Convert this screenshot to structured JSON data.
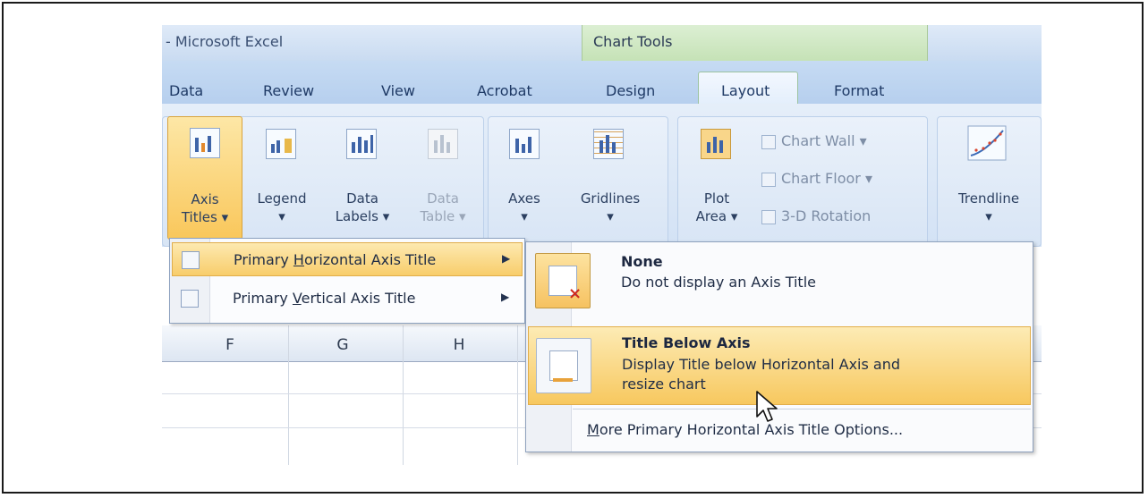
{
  "window": {
    "title": "- Microsoft Excel",
    "context_tab_group": "Chart Tools"
  },
  "tabs": [
    {
      "label": "Data"
    },
    {
      "label": "Review"
    },
    {
      "label": "View"
    },
    {
      "label": "Acrobat"
    },
    {
      "label": "Design"
    },
    {
      "label": "Layout"
    },
    {
      "label": "Format"
    }
  ],
  "ribbon": {
    "axis_titles": {
      "line1": "Axis",
      "line2": "Titles ▾"
    },
    "legend": {
      "line1": "Legend",
      "line2": "▾"
    },
    "data_labels": {
      "line1": "Data",
      "line2": "Labels ▾"
    },
    "data_table": {
      "line1": "Data",
      "line2": "Table ▾"
    },
    "axes": {
      "line1": "Axes",
      "line2": "▾"
    },
    "gridlines": {
      "line1": "Gridlines",
      "line2": "▾"
    },
    "plot_area": {
      "line1": "Plot",
      "line2": "Area ▾"
    },
    "chart_wall": "Chart Wall ▾",
    "chart_floor": "Chart Floor ▾",
    "rotation": "3-D Rotation",
    "trendline": {
      "line1": "Trendline",
      "line2": "▾"
    }
  },
  "columns": [
    "F",
    "G",
    "H"
  ],
  "axis_menu": {
    "items": [
      {
        "label": "Primary Horizontal Axis Title",
        "accel": "H",
        "selected": true
      },
      {
        "label": "Primary Vertical Axis Title",
        "accel": "V",
        "selected": false
      }
    ]
  },
  "horizontal_submenu": {
    "options": [
      {
        "title": "None",
        "desc1": "Do not display an Axis Title",
        "desc2": ""
      },
      {
        "title": "Title Below Axis",
        "desc1": "Display Title below Horizontal Axis and",
        "desc2": "resize chart"
      }
    ],
    "more": "More Primary Horizontal Axis Title Options..."
  }
}
